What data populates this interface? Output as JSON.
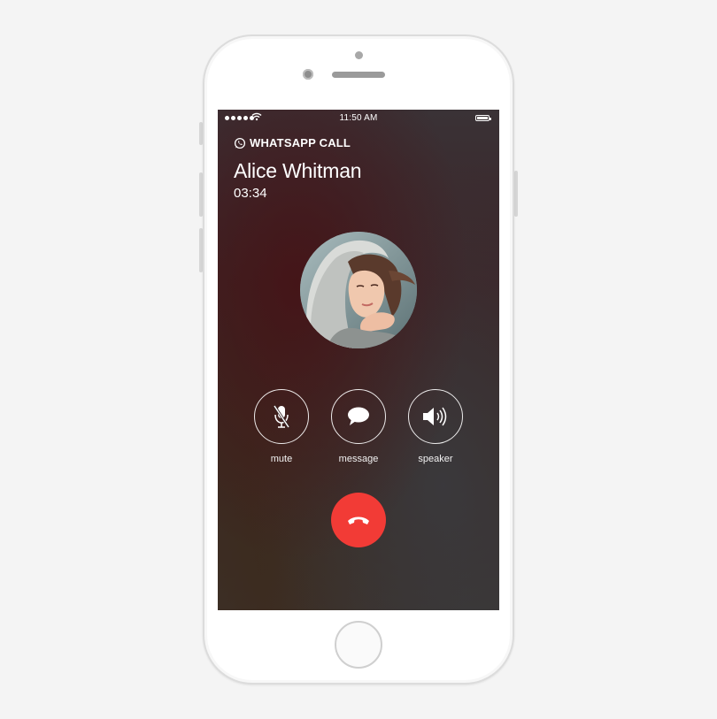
{
  "status_bar": {
    "time": "11:50 AM",
    "icons": [
      "signal-dots-icon",
      "wifi-icon",
      "battery-icon"
    ]
  },
  "call": {
    "label": "WHATSAPP CALL",
    "contact_name": "Alice Whitman",
    "duration": "03:34"
  },
  "actions": [
    {
      "id": "mute",
      "label": "mute",
      "icon": "microphone-muted-icon"
    },
    {
      "id": "message",
      "label": "message",
      "icon": "speech-bubble-icon"
    },
    {
      "id": "speaker",
      "label": "speaker",
      "icon": "speaker-icon"
    }
  ],
  "end_call": {
    "icon": "phone-hangup-icon",
    "color": "#f23b36"
  },
  "colors": {
    "background": "#f4f4f4",
    "phone_body": "#ffffff",
    "accent_end_call": "#f23b36",
    "text": "#ffffff"
  }
}
